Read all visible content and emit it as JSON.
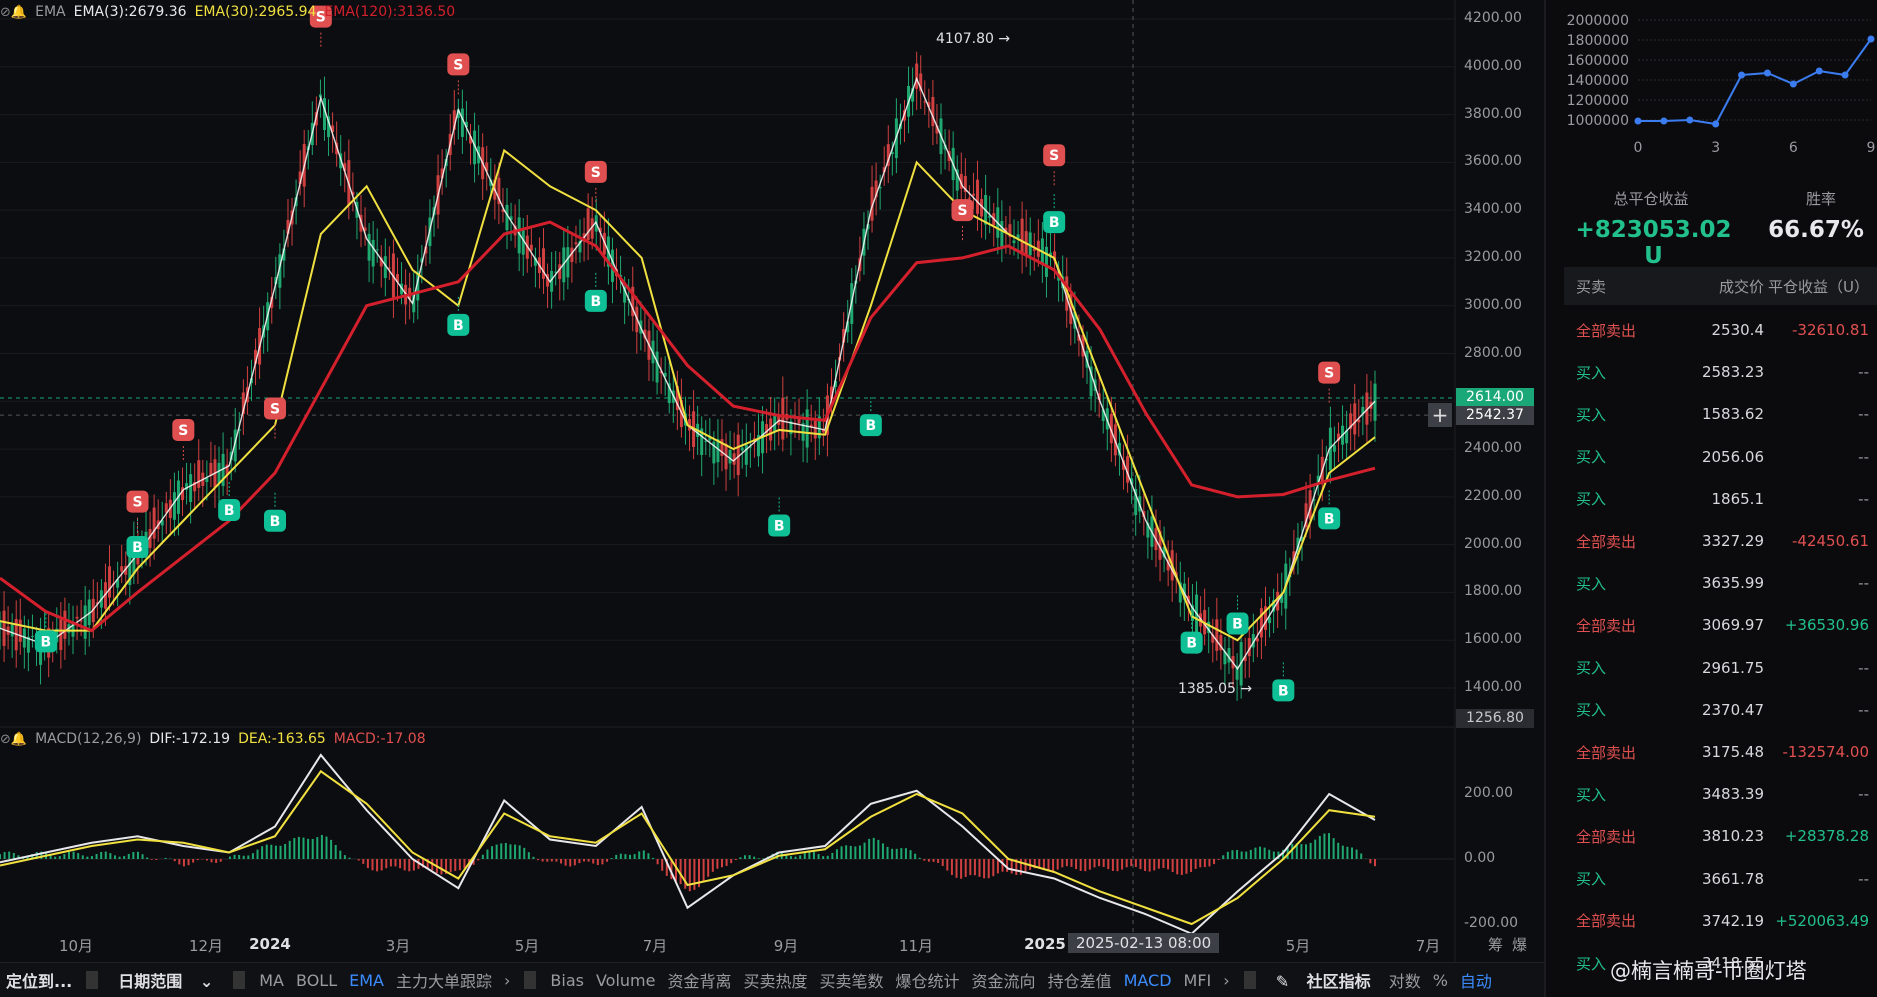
{
  "ema_legend": {
    "label": "EMA",
    "ema3": "EMA(3):2679.36",
    "ema30": "EMA(30):2965.94",
    "ema120": "EMA(120):3136.50"
  },
  "macd_legend": {
    "label": "MACD(12,26,9)",
    "dif": "DIF:-172.19",
    "dea": "DEA:-163.65",
    "macd": "MACD:-17.08"
  },
  "y_axis_main": [
    "4200.00",
    "4000.00",
    "3800.00",
    "3600.00",
    "3400.00",
    "3200.00",
    "3000.00",
    "2800.00",
    "2600.00",
    "2400.00",
    "2200.00",
    "2000.00",
    "1800.00",
    "1600.00",
    "1400.00"
  ],
  "y_axis_macd": [
    "200.00",
    "0.00",
    "-200.00"
  ],
  "x_axis": [
    "10月",
    "12月",
    "2024",
    "3月",
    "5月",
    "7月",
    "9月",
    "11月",
    "2025",
    "5月",
    "7月"
  ],
  "crosshair_date": "2025-02-13 08:00",
  "price_tags": {
    "current": "2614.00",
    "crosshair": "2542.37",
    "low_tag": "1256.80"
  },
  "annotations": {
    "high": "4107.80 →",
    "low": "1385.05 →"
  },
  "signals": {
    "buy": "B",
    "sell": "S"
  },
  "colors": {
    "ema3": "#ffffff",
    "ema30": "#f0e040",
    "ema120": "#d4202c",
    "buy": "#0fbf95",
    "sell": "#e05050",
    "up": "#1fa870",
    "down": "#d04040"
  },
  "chart_data": {
    "type": "line",
    "title": "",
    "series": [
      {
        "name": "EMA(3)",
        "values": [
          1650,
          1580,
          1720,
          1960,
          2230,
          2330,
          3080,
          3870,
          3280,
          3010,
          3820,
          3400,
          3100,
          3350,
          2900,
          2500,
          2350,
          2520,
          2480,
          3400,
          3950,
          3500,
          3300,
          3200,
          2600,
          2100,
          1740,
          1480,
          1800,
          2400,
          2600
        ]
      },
      {
        "name": "EMA(30)",
        "values": [
          1680,
          1640,
          1640,
          1900,
          2100,
          2300,
          2500,
          3300,
          3500,
          3150,
          3000,
          3650,
          3500,
          3400,
          3200,
          2500,
          2400,
          2480,
          2460,
          3000,
          3600,
          3400,
          3300,
          3200,
          2700,
          2200,
          1700,
          1600,
          1800,
          2300,
          2450
        ]
      },
      {
        "name": "EMA(120)",
        "values": [
          1860,
          1720,
          1640,
          1800,
          1950,
          2100,
          2300,
          2650,
          3000,
          3050,
          3100,
          3300,
          3350,
          3250,
          3000,
          2750,
          2580,
          2540,
          2520,
          2950,
          3180,
          3200,
          3250,
          3150,
          2900,
          2550,
          2250,
          2200,
          2210,
          2270,
          2320
        ]
      }
    ],
    "high": 4107.8,
    "low": 1385.05,
    "ylim": [
      1300,
      4250
    ],
    "macd": {
      "dif": [
        -10,
        20,
        50,
        70,
        40,
        20,
        100,
        320,
        150,
        0,
        -90,
        180,
        60,
        40,
        160,
        -150,
        -50,
        20,
        40,
        170,
        210,
        100,
        -30,
        -60,
        -120,
        -170,
        -230,
        -100,
        20,
        200,
        120
      ],
      "dea": [
        -20,
        10,
        40,
        60,
        50,
        20,
        70,
        270,
        170,
        20,
        -60,
        140,
        70,
        50,
        140,
        -80,
        -50,
        10,
        30,
        130,
        200,
        140,
        0,
        -40,
        -100,
        -150,
        -200,
        -120,
        0,
        150,
        130
      ]
    },
    "buys": [
      [
        1,
        1595
      ],
      [
        3,
        1990
      ],
      [
        5,
        2145
      ],
      [
        6,
        2100
      ],
      [
        10,
        2920
      ],
      [
        13,
        3020
      ],
      [
        17,
        2080
      ],
      [
        19,
        2500
      ],
      [
        23,
        3350
      ],
      [
        26,
        1590
      ],
      [
        27,
        1670
      ],
      [
        28,
        1390
      ],
      [
        29,
        2110
      ]
    ],
    "sells": [
      [
        3,
        2180
      ],
      [
        4,
        2480
      ],
      [
        6,
        2570
      ],
      [
        7,
        4210
      ],
      [
        10,
        4010
      ],
      [
        13,
        3560
      ],
      [
        21,
        3400
      ],
      [
        23,
        3630
      ],
      [
        29,
        2720
      ]
    ]
  },
  "right_panel": {
    "mini_chart": {
      "y_labels": [
        "2000000",
        "1800000",
        "1600000",
        "1400000",
        "1200000",
        "1000000"
      ],
      "x_labels": [
        "0",
        "3",
        "6",
        "9"
      ],
      "values": [
        990000,
        990000,
        1000000,
        960000,
        1450000,
        1470000,
        1360000,
        1490000,
        1450000,
        1810000
      ]
    },
    "total_pnl_label": "总平仓收益",
    "total_pnl": "+823053.02 U",
    "win_rate_label": "胜率",
    "win_rate": "66.67%",
    "table_headers": {
      "side": "买卖",
      "price": "成交价",
      "pnl": "平仓收益（U）"
    },
    "rows": [
      {
        "side": "全部卖出",
        "price": "2530.4",
        "pnl": "-32610.81",
        "kind": "sell",
        "pnl_kind": "neg"
      },
      {
        "side": "买入",
        "price": "2583.23",
        "pnl": "--",
        "kind": "buy",
        "pnl_kind": "none"
      },
      {
        "side": "买入",
        "price": "1583.62",
        "pnl": "--",
        "kind": "buy",
        "pnl_kind": "none"
      },
      {
        "side": "买入",
        "price": "2056.06",
        "pnl": "--",
        "kind": "buy",
        "pnl_kind": "none"
      },
      {
        "side": "买入",
        "price": "1865.1",
        "pnl": "--",
        "kind": "buy",
        "pnl_kind": "none"
      },
      {
        "side": "全部卖出",
        "price": "3327.29",
        "pnl": "-42450.61",
        "kind": "sell",
        "pnl_kind": "neg"
      },
      {
        "side": "买入",
        "price": "3635.99",
        "pnl": "--",
        "kind": "buy",
        "pnl_kind": "none"
      },
      {
        "side": "全部卖出",
        "price": "3069.97",
        "pnl": "+36530.96",
        "kind": "sell",
        "pnl_kind": "pos"
      },
      {
        "side": "买入",
        "price": "2961.75",
        "pnl": "--",
        "kind": "buy",
        "pnl_kind": "none"
      },
      {
        "side": "买入",
        "price": "2370.47",
        "pnl": "--",
        "kind": "buy",
        "pnl_kind": "none"
      },
      {
        "side": "全部卖出",
        "price": "3175.48",
        "pnl": "-132574.00",
        "kind": "sell",
        "pnl_kind": "neg"
      },
      {
        "side": "买入",
        "price": "3483.39",
        "pnl": "--",
        "kind": "buy",
        "pnl_kind": "none"
      },
      {
        "side": "全部卖出",
        "price": "3810.23",
        "pnl": "+28378.28",
        "kind": "sell",
        "pnl_kind": "pos"
      },
      {
        "side": "买入",
        "price": "3661.78",
        "pnl": "--",
        "kind": "buy",
        "pnl_kind": "none"
      },
      {
        "side": "全部卖出",
        "price": "3742.19",
        "pnl": "+520063.49",
        "kind": "sell",
        "pnl_kind": "pos"
      },
      {
        "side": "买入",
        "price": "3418.55",
        "pnl": "",
        "kind": "buy",
        "pnl_kind": "none"
      }
    ]
  },
  "toolbar": {
    "locate": "定位到...",
    "date_range": "日期范围",
    "indicators": [
      "MA",
      "BOLL",
      "EMA",
      "主力大单跟踪"
    ],
    "subs": [
      "Bias",
      "Volume",
      "资金背离",
      "买卖热度",
      "买卖笔数",
      "爆仓统计",
      "资金流向",
      "持仓差值",
      "MACD",
      "MFI"
    ],
    "community": "社区指标",
    "log": "对数",
    "pct": "%",
    "auto": "自动",
    "right_labels": [
      "筹",
      "爆"
    ]
  },
  "watermark": "@楠言楠哥-币圈灯塔"
}
